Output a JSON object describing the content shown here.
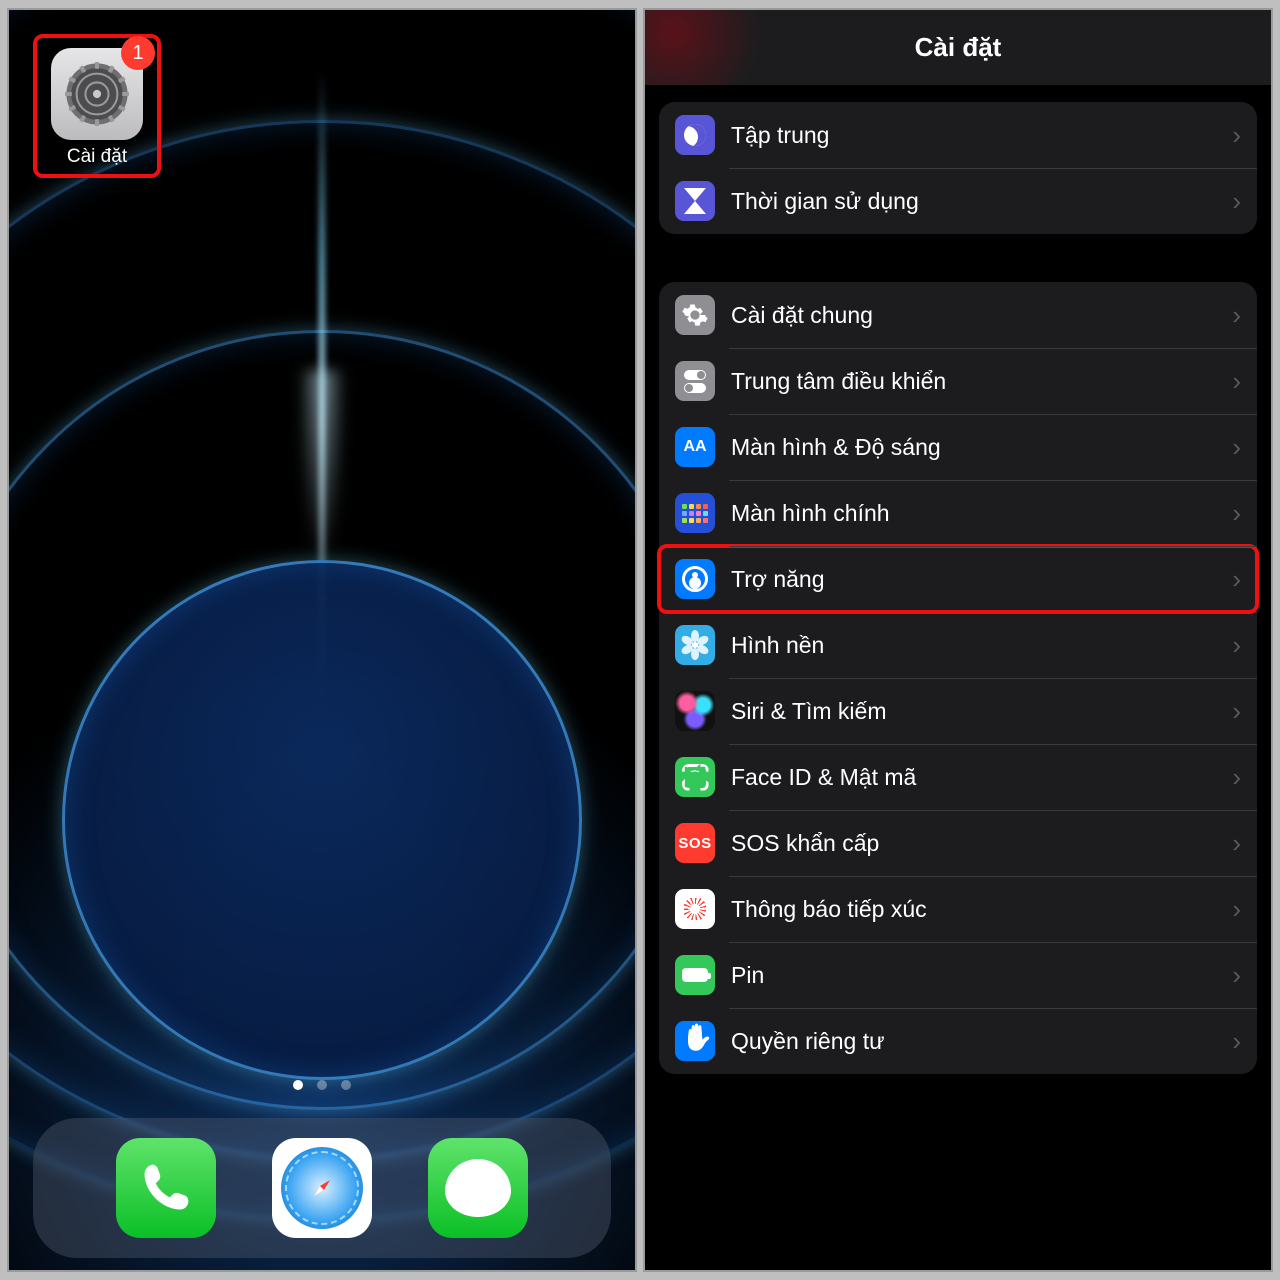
{
  "home": {
    "app_label": "Cài đặt",
    "badge": "1",
    "dock": {
      "phone": "Phone",
      "safari": "Safari",
      "messages": "Messages"
    }
  },
  "settings": {
    "title": "Cài đặt",
    "group1": [
      {
        "key": "focus",
        "label": "Tập trung",
        "icon": "moon-icon"
      },
      {
        "key": "screentime",
        "label": "Thời gian sử dụng",
        "icon": "hourglass-icon"
      }
    ],
    "group2": [
      {
        "key": "general",
        "label": "Cài đặt chung",
        "icon": "gear-icon"
      },
      {
        "key": "controlcenter",
        "label": "Trung tâm điều khiển",
        "icon": "switches-icon"
      },
      {
        "key": "display",
        "label": "Màn hình & Độ sáng",
        "icon": "aa-icon"
      },
      {
        "key": "homescreen",
        "label": "Màn hình chính",
        "icon": "appgrid-icon"
      },
      {
        "key": "accessibility",
        "label": "Trợ năng",
        "icon": "accessibility-icon",
        "highlight": true
      },
      {
        "key": "wallpaper",
        "label": "Hình nền",
        "icon": "flower-icon"
      },
      {
        "key": "siri",
        "label": "Siri & Tìm kiếm",
        "icon": "siri-icon"
      },
      {
        "key": "faceid",
        "label": "Face ID & Mật mã",
        "icon": "faceid-icon"
      },
      {
        "key": "sos",
        "label": "SOS khẩn cấp",
        "icon": "sos-icon"
      },
      {
        "key": "exposure",
        "label": "Thông báo tiếp xúc",
        "icon": "exposure-icon"
      },
      {
        "key": "battery",
        "label": "Pin",
        "icon": "battery-icon"
      },
      {
        "key": "privacy",
        "label": "Quyền riêng tư",
        "icon": "hand-icon"
      }
    ],
    "aa_text": "AA",
    "sos_text": "SOS"
  },
  "colors": {
    "highlight": "#e11",
    "indigo": "#5856d6",
    "blue": "#007aff",
    "cyan": "#32ade6",
    "green": "#34c759",
    "red": "#ff3b30",
    "gray": "#8e8e93"
  }
}
